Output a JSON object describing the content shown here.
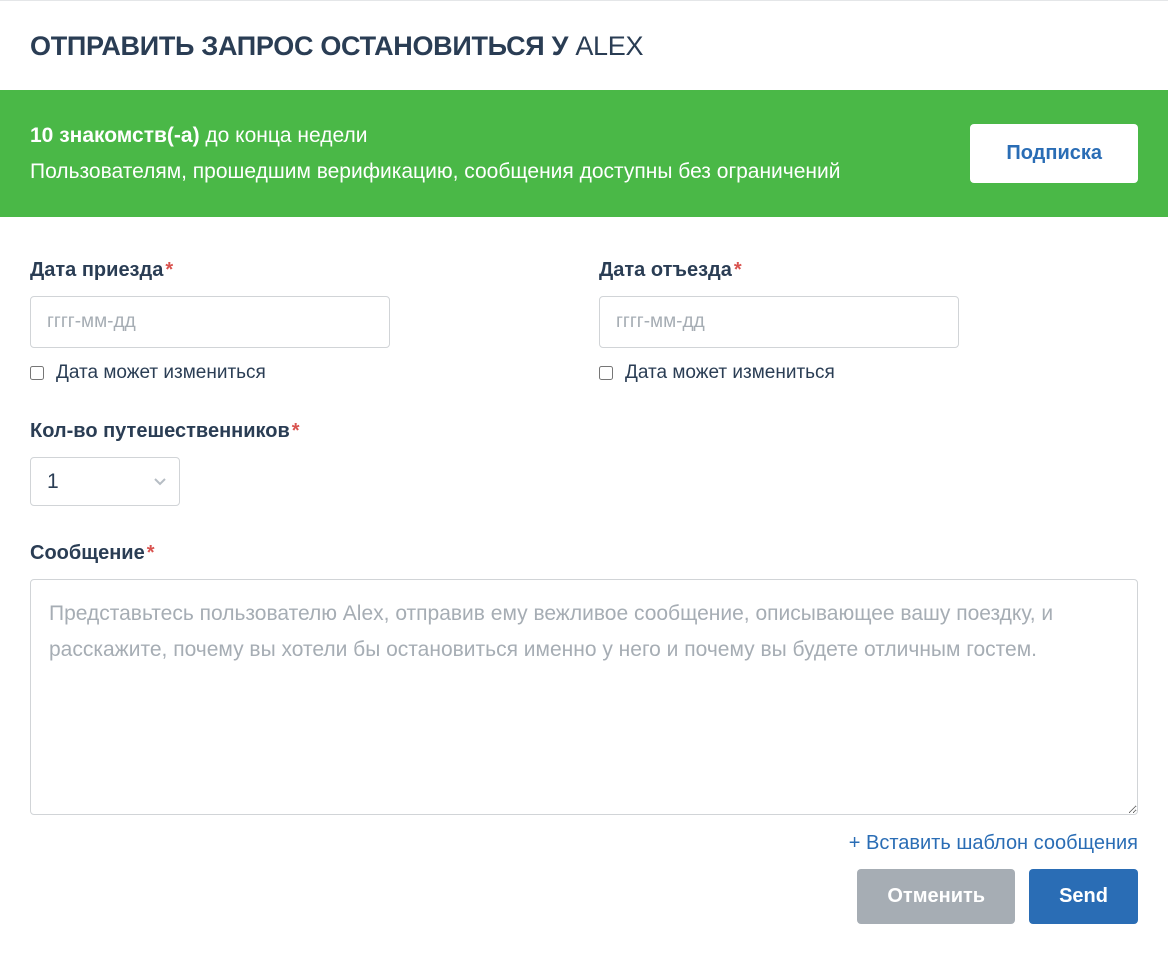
{
  "title": {
    "prefix": "ОТПРАВИТЬ ЗАПРОС ОСТАНОВИТЬСЯ У ",
    "name": "ALEX"
  },
  "banner": {
    "bold": "10 знакомств(-а)",
    "rest_line1": " до конца недели",
    "line2": "Пользователям, прошедшим верификацию, сообщения доступны без ограничений",
    "button": "Подписка"
  },
  "arrival": {
    "label": "Дата приезда",
    "placeholder": "гггг-мм-дд",
    "flexible": "Дата может измениться"
  },
  "departure": {
    "label": "Дата отъезда",
    "placeholder": "гггг-мм-дд",
    "flexible": "Дата может измениться"
  },
  "travelers": {
    "label": "Кол-во путешественников",
    "value": "1"
  },
  "message": {
    "label": "Сообщение",
    "placeholder": "Представьтесь пользователю Alex, отправив ему вежливое сообщение, описывающее вашу поездку, и расскажите, почему вы хотели бы остановиться именно у него и почему вы будете отличным гостем."
  },
  "template_link": "+ Вставить шаблон сообщения",
  "buttons": {
    "cancel": "Отменить",
    "send": "Send"
  }
}
